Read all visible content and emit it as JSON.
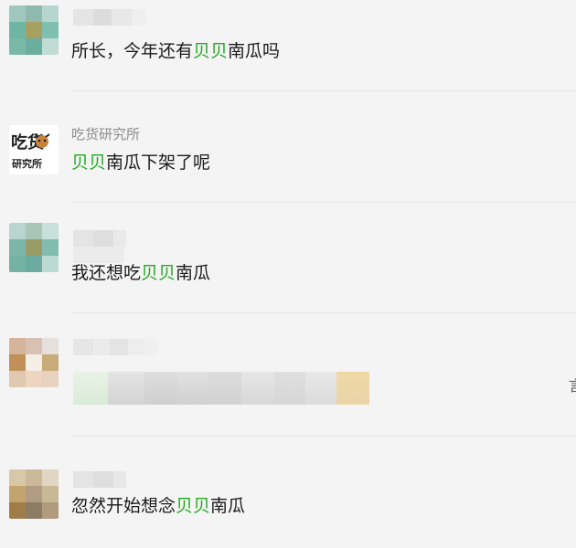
{
  "comments": [
    {
      "avatar": "blurred-avatar",
      "nickname": "",
      "message_parts": [
        {
          "text": "所长，今年还有",
          "highlight": false
        },
        {
          "text": "贝贝",
          "highlight": true
        },
        {
          "text": "南瓜吗",
          "highlight": false
        }
      ]
    },
    {
      "avatar": "吃货研究所-logo",
      "logo_text_top": "吃货",
      "logo_text_bottom": "研究所",
      "nickname": "吃货研究所",
      "message_parts": [
        {
          "text": "贝贝",
          "highlight": true
        },
        {
          "text": "南瓜下架了呢",
          "highlight": false
        }
      ]
    },
    {
      "avatar": "blurred-avatar",
      "nickname": "",
      "message_parts": [
        {
          "text": "我还想吃",
          "highlight": false
        },
        {
          "text": "贝贝",
          "highlight": true
        },
        {
          "text": "南瓜",
          "highlight": false
        }
      ]
    },
    {
      "avatar": "blurred-avatar",
      "nickname": "",
      "message_parts": []
    },
    {
      "avatar": "blurred-avatar",
      "nickname": "",
      "message_parts": [
        {
          "text": "忽然开始想念",
          "highlight": false
        },
        {
          "text": "贝贝",
          "highlight": true
        },
        {
          "text": "南瓜",
          "highlight": false
        }
      ]
    }
  ],
  "edge_glyph": "言",
  "colors": {
    "background": "#f4f4f4",
    "highlight": "#26a827",
    "separator": "#e6e6e6",
    "nickname": "#8c8c8c"
  }
}
